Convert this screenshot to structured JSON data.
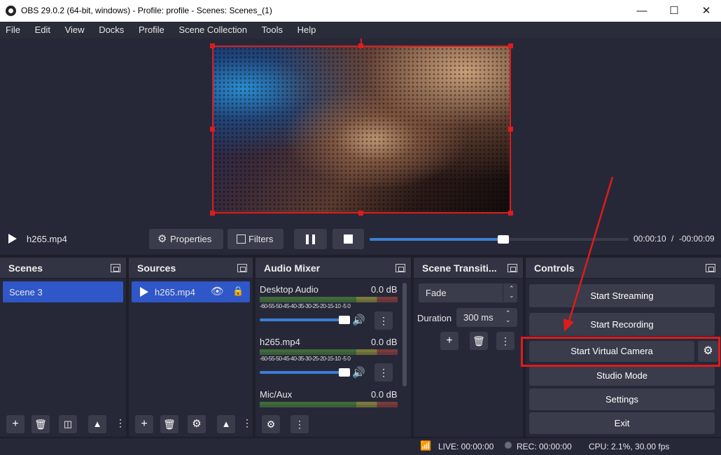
{
  "window": {
    "title": "OBS 29.0.2 (64-bit, windows) - Profile: profile - Scenes: Scenes_(1)"
  },
  "menu": [
    "File",
    "Edit",
    "View",
    "Docks",
    "Profile",
    "Scene Collection",
    "Tools",
    "Help"
  ],
  "media": {
    "name": "h265.mp4",
    "properties": "Properties",
    "filters": "Filters",
    "current_time": "00:00:10",
    "separator": "/",
    "remaining_time": "-00:00:09",
    "progress": 0.515
  },
  "scenes": {
    "title": "Scenes",
    "items": [
      "Scene 3"
    ]
  },
  "sources": {
    "title": "Sources",
    "items": [
      "h265.mp4"
    ]
  },
  "mixer": {
    "title": "Audio Mixer",
    "scale": "-60-55-50-45-40-35-30-25-20-15-10 -5  0",
    "channels": [
      {
        "name": "Desktop Audio",
        "db": "0.0 dB"
      },
      {
        "name": "h265.mp4",
        "db": "0.0 dB"
      },
      {
        "name": "Mic/Aux",
        "db": "0.0 dB"
      }
    ]
  },
  "transitions": {
    "title": "Scene Transiti...",
    "selected": "Fade",
    "duration_label": "Duration",
    "duration_value": "300 ms"
  },
  "controls": {
    "title": "Controls",
    "start_streaming": "Start Streaming",
    "start_recording": "Start Recording",
    "start_virtual_camera": "Start Virtual Camera",
    "studio_mode": "Studio Mode",
    "settings": "Settings",
    "exit": "Exit"
  },
  "status": {
    "live": "LIVE: 00:00:00",
    "rec": "REC: 00:00:00",
    "cpu": "CPU: 2.1%, 30.00 fps"
  },
  "annotation_color": "#e01b1b"
}
